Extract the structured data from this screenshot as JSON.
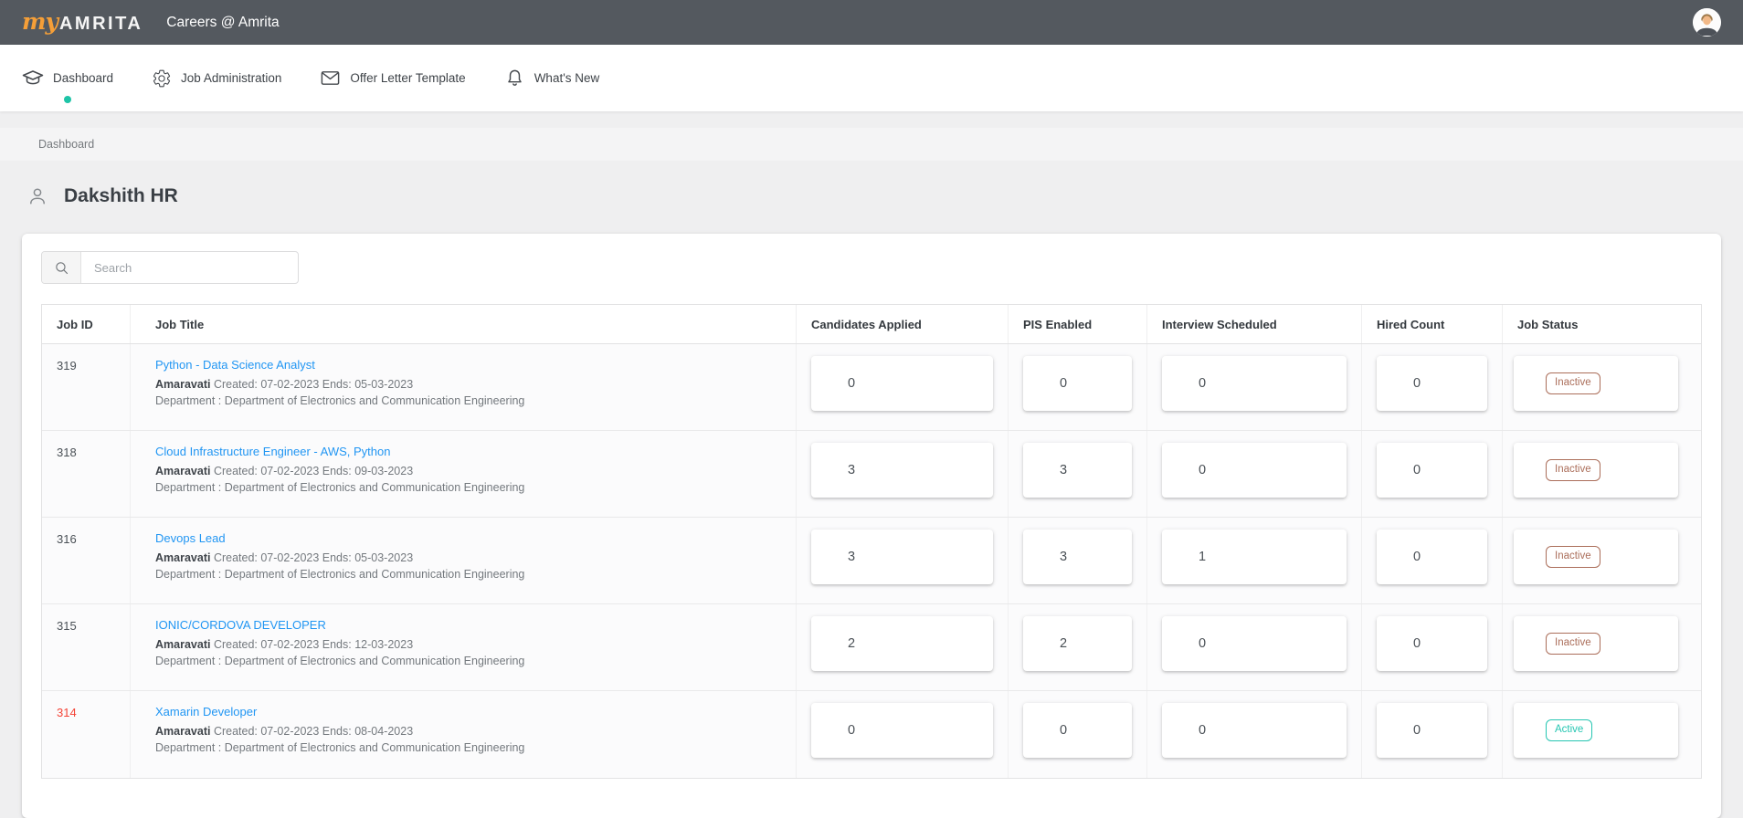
{
  "topbar": {
    "logo_script": "my",
    "logo_text": "AMRITA",
    "app_title": "Careers @ Amrita"
  },
  "nav": {
    "items": [
      {
        "label": "Dashboard",
        "icon": "graduation-cap-icon",
        "active": true
      },
      {
        "label": "Job Administration",
        "icon": "gear-icon",
        "active": false
      },
      {
        "label": "Offer Letter Template",
        "icon": "envelope-icon",
        "active": false
      },
      {
        "label": "What's New",
        "icon": "bell-icon",
        "active": false
      }
    ]
  },
  "breadcrumb": {
    "label": "Dashboard"
  },
  "page": {
    "title": "Dakshith HR",
    "title_icon": "person-icon"
  },
  "search": {
    "placeholder": "Search",
    "icon": "search-icon"
  },
  "table": {
    "columns": [
      "Job ID",
      "Job Title",
      "Candidates Applied",
      "PIS Enabled",
      "Interview Scheduled",
      "Hired Count",
      "Job Status"
    ],
    "rows": [
      {
        "job_id": "319",
        "job_id_red": false,
        "title": "Python - Data Science Analyst",
        "location": "Amaravati",
        "schedule": "Created: 07-02-2023 Ends: 05-03-2023",
        "department": "Department : Department of Electronics and Communication Engineering",
        "candidates_applied": "0",
        "pis_enabled": "0",
        "interview_scheduled": "0",
        "hired_count": "0",
        "job_status": "Inactive"
      },
      {
        "job_id": "318",
        "job_id_red": false,
        "title": "Cloud Infrastructure Engineer - AWS, Python",
        "location": "Amaravati",
        "schedule": "Created: 07-02-2023 Ends: 09-03-2023",
        "department": "Department : Department of Electronics and Communication Engineering",
        "candidates_applied": "3",
        "pis_enabled": "3",
        "interview_scheduled": "0",
        "hired_count": "0",
        "job_status": "Inactive"
      },
      {
        "job_id": "316",
        "job_id_red": false,
        "title": "Devops Lead",
        "location": "Amaravati",
        "schedule": "Created: 07-02-2023 Ends: 05-03-2023",
        "department": "Department : Department of Electronics and Communication Engineering",
        "candidates_applied": "3",
        "pis_enabled": "3",
        "interview_scheduled": "1",
        "hired_count": "0",
        "job_status": "Inactive"
      },
      {
        "job_id": "315",
        "job_id_red": false,
        "title": "IONIC/CORDOVA DEVELOPER",
        "location": "Amaravati",
        "schedule": "Created: 07-02-2023 Ends: 12-03-2023",
        "department": "Department : Department of Electronics and Communication Engineering",
        "candidates_applied": "2",
        "pis_enabled": "2",
        "interview_scheduled": "0",
        "hired_count": "0",
        "job_status": "Inactive"
      },
      {
        "job_id": "314",
        "job_id_red": true,
        "title": "Xamarin Developer",
        "location": "Amaravati",
        "schedule": "Created: 07-02-2023 Ends: 08-04-2023",
        "department": "Department : Department of Electronics and Communication Engineering",
        "candidates_applied": "0",
        "pis_enabled": "0",
        "interview_scheduled": "0",
        "hired_count": "0",
        "job_status": "Active"
      }
    ]
  },
  "colors": {
    "topbar_bg": "#54595f",
    "brand_orange": "#f59f38",
    "active_dot": "#1ec4a7",
    "link_blue": "#2196f3",
    "inactive_badge": "#ab6e5a",
    "active_badge": "#26c6b2",
    "red_job_id": "#f44336"
  }
}
